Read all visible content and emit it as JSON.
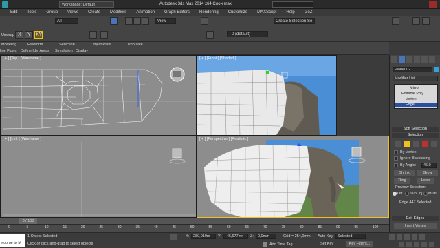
{
  "app": {
    "title_center": "Autodesk 3ds Max  2014 x64    Слон.max",
    "workspace": "Workspace: Default"
  },
  "menu": [
    "Edit",
    "Tools",
    "Group",
    "Views",
    "Create",
    "Modifiers",
    "Animation",
    "Graph Editors",
    "Rendering",
    "Customize",
    "MAXScript",
    "Help",
    "GoZ"
  ],
  "toolbar": {
    "selection_filter": "All",
    "view_select": "View",
    "unwrap": "Unwrap",
    "layer": "0 (default)",
    "named_selection": "Create Selection Se",
    "axis_x": "X",
    "axis_y": "Y",
    "axis_xy": "XY"
  },
  "ribbon": {
    "tabs": [
      "Modeling",
      "Freeform",
      "Selection",
      "Object Paint",
      "Populate"
    ],
    "sub": [
      "line Flows",
      "Define Idle Areas",
      "Simulation",
      "Display"
    ]
  },
  "viewports": {
    "top": "[ + ] [Top ] [Wireframe ]",
    "front": "[ + ] [Front ] [Shaded ]",
    "left": "[ + ] [Left ] [Wireframe ]",
    "persp": "[ + ] [Perspective ] [Realistic ]"
  },
  "command_panel": {
    "object_name": "Plane002",
    "modifier_list": "Modifier List",
    "stack": [
      "Mirror",
      "Editable Poly",
      "Vertex",
      "Edge"
    ],
    "soft_selection": "Soft Selection",
    "selection": "Selection",
    "by_vertex": "By Vertex",
    "ignore_backfacing": "Ignore Backfacing",
    "by_angle": "By Angle:",
    "angle_value": "45,0",
    "shrink": "Shrink",
    "grow": "Grow",
    "ring": "Ring",
    "loop": "Loop",
    "preview_selection": "Preview Selection",
    "off": "Off",
    "subobj": "SubObj",
    "multi": "Multi",
    "edge_selected": "Edge 447 Selected",
    "edit_edges": "Edit Edges",
    "insert_vertex": "Insert Vertex"
  },
  "timeline": {
    "frame_counter": "0 / 100",
    "ticks": [
      "0",
      "5",
      "10",
      "15",
      "20",
      "25",
      "30",
      "35",
      "40",
      "45",
      "50",
      "55",
      "60",
      "65",
      "70",
      "75",
      "80",
      "85",
      "90",
      "95",
      "100"
    ]
  },
  "status": {
    "objects_selected": "1 Object Selected",
    "hint": "Click or click-and-drag to select objects",
    "x_label": "X:",
    "x_value": "280,019m",
    "y_label": "Y:",
    "y_value": "-46,677mr",
    "z_label": "Z:",
    "z_value": "0,0mm",
    "grid": "Grid = 254,0mm",
    "auto_key": "Auto Key",
    "selected": "Selected",
    "set_key": "Set Key",
    "key_filters": "Key Filters...",
    "add_time_tag": "Add Time Tag",
    "listener": "elcome to M"
  },
  "colors": {
    "accent": "#f0c020",
    "sky": "#4a8fd6",
    "selection": "#2a4fa0"
  }
}
